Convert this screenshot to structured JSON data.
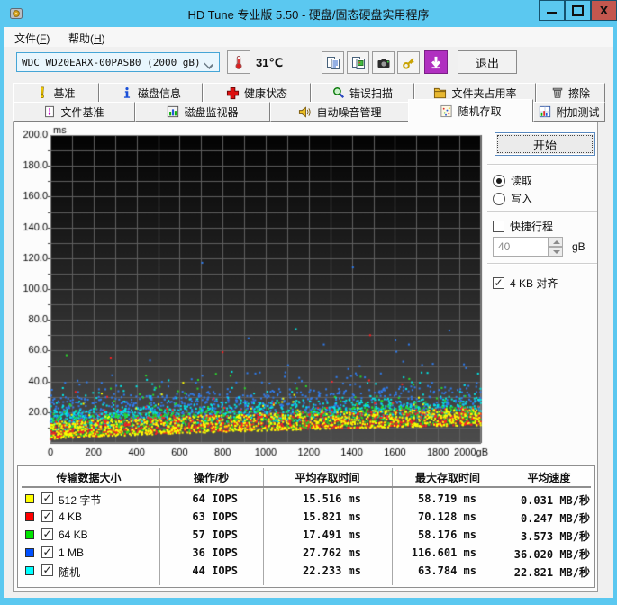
{
  "window": {
    "title": "HD Tune 专业版 5.50 - 硬盘/固态硬盘实用程序",
    "controls": {
      "minimize": "minimize",
      "maximize": "maximize",
      "close": "close"
    }
  },
  "menu": {
    "items": [
      {
        "pre": "文件(",
        "key": "F",
        "post": ")"
      },
      {
        "pre": "帮助(",
        "key": "H",
        "post": ")"
      }
    ]
  },
  "toolbar": {
    "drive_selected": "WDC WD20EARX-00PASB0 (2000 gB)",
    "temperature": "31℃",
    "exit_label": "退出"
  },
  "icons": {
    "titlebar": "hdd-icon",
    "toolbar": [
      "thermometer-icon",
      "copy-text-icon",
      "copy-image-icon",
      "camera-icon",
      "key-icon",
      "download-arrow-icon"
    ],
    "tabs": [
      "exclamation-icon",
      "info-icon",
      "health-cross-icon",
      "magnifier-icon",
      "folder-icon",
      "trash-icon",
      "file-exclamation-icon",
      "bar-chart-icon",
      "speaker-icon",
      "scatter-page-icon",
      "grid-chart-icon"
    ]
  },
  "tabs": {
    "row1": [
      {
        "label": "基准"
      },
      {
        "label": "磁盘信息"
      },
      {
        "label": "健康状态"
      },
      {
        "label": "错误扫描"
      },
      {
        "label": "文件夹占用率"
      },
      {
        "label": "擦除"
      }
    ],
    "row2": [
      {
        "label": "文件基准"
      },
      {
        "label": "磁盘监视器"
      },
      {
        "label": "自动噪音管理"
      },
      {
        "label": "随机存取",
        "active": true
      },
      {
        "label": "附加测试"
      }
    ]
  },
  "controls": {
    "start_label": "开始",
    "read_label": "读取",
    "write_label": "写入",
    "read_selected": true,
    "short_stroke_label": "快捷行程",
    "short_stroke_checked": false,
    "capacity_value": "40",
    "capacity_unit": "gB",
    "align_label": "4 KB 对齐",
    "align_checked": true
  },
  "chart_data": {
    "type": "scatter",
    "title": "随机存取 access time scatter",
    "x_unit": "gB",
    "y_unit": "ms",
    "xlim": [
      0,
      2000
    ],
    "ylim": [
      0,
      200
    ],
    "x_ticks": [
      0,
      200,
      400,
      600,
      800,
      1000,
      1200,
      1400,
      1600,
      1800,
      2000
    ],
    "x_last_tick_label": "2000gB",
    "y_ticks": [
      20,
      40,
      60,
      80,
      100,
      120,
      140,
      160,
      180,
      200
    ],
    "grid": {
      "x_step": 100,
      "y_step": 10,
      "on": true
    },
    "plot_colors": {
      "bg_top": "#030303",
      "bg_bottom": "#4c4c4c",
      "grid": "#606060",
      "frame": "#838383"
    },
    "envelope": {
      "start_ms": 1.5,
      "end_ms": 11,
      "power": 0.7
    },
    "series": [
      {
        "name": "512 字节",
        "color": "#ffff00",
        "avg_ms": 15.516,
        "max_ms": 58.719,
        "count": 950,
        "offset": 0.5,
        "band": 11,
        "tail_prob": 0.1,
        "tail_scale": 4
      },
      {
        "name": "4 KB",
        "color": "#ff2222",
        "avg_ms": 15.821,
        "max_ms": 70.128,
        "count": 950,
        "offset": 0.8,
        "band": 11,
        "tail_prob": 0.1,
        "tail_scale": 5
      },
      {
        "name": "64 KB",
        "color": "#2adc2a",
        "avg_ms": 17.491,
        "max_ms": 58.176,
        "count": 900,
        "offset": 1.5,
        "band": 13,
        "tail_prob": 0.18,
        "tail_scale": 6
      },
      {
        "name": "1 MB",
        "color": "#2f7df0",
        "avg_ms": 27.762,
        "max_ms": 116.601,
        "count": 800,
        "offset": 11,
        "band": 16,
        "tail_prob": 0.2,
        "tail_scale": 7
      },
      {
        "name": "随机",
        "color": "#00e8e8",
        "avg_ms": 22.233,
        "max_ms": 63.784,
        "count": 850,
        "offset": 6,
        "band": 13,
        "tail_prob": 0.18,
        "tail_scale": 6
      }
    ],
    "outliers": [
      {
        "x": 705,
        "y": 117,
        "series": 3
      },
      {
        "x": 1405,
        "y": 114,
        "series": 3
      },
      {
        "x": 1140,
        "y": 74,
        "series": 4
      },
      {
        "x": 920,
        "y": 68,
        "series": 3
      },
      {
        "x": 1270,
        "y": 64,
        "series": 3
      },
      {
        "x": 1665,
        "y": 64,
        "series": 3
      },
      {
        "x": 1485,
        "y": 70,
        "series": 1
      },
      {
        "x": 800,
        "y": 59,
        "series": 1
      },
      {
        "x": 75,
        "y": 57,
        "series": 2
      },
      {
        "x": 280,
        "y": 55,
        "series": 1
      }
    ]
  },
  "table": {
    "headers": [
      "传输数据大小",
      "操作/秒",
      "平均存取时间",
      "最大存取时间",
      "平均速度"
    ],
    "rows": [
      {
        "color": "#ffff00",
        "checked": true,
        "label": "512 字节",
        "iops": "64 IOPS",
        "avg": "15.516 ms",
        "max": "58.719 ms",
        "speed": "0.031 MB/秒"
      },
      {
        "color": "#ff0000",
        "checked": true,
        "label": "4 KB",
        "iops": "63 IOPS",
        "avg": "15.821 ms",
        "max": "70.128 ms",
        "speed": "0.247 MB/秒"
      },
      {
        "color": "#00e400",
        "checked": true,
        "label": "64 KB",
        "iops": "57 IOPS",
        "avg": "17.491 ms",
        "max": "58.176 ms",
        "speed": "3.573 MB/秒"
      },
      {
        "color": "#0050ff",
        "checked": true,
        "label": "1 MB",
        "iops": "36 IOPS",
        "avg": "27.762 ms",
        "max": "116.601 ms",
        "speed": "36.020 MB/秒"
      },
      {
        "color": "#00ffff",
        "checked": true,
        "label": "随机",
        "iops": "44 IOPS",
        "avg": "22.233 ms",
        "max": "63.784 ms",
        "speed": "22.821 MB/秒"
      }
    ],
    "check_glyph": "✓"
  }
}
